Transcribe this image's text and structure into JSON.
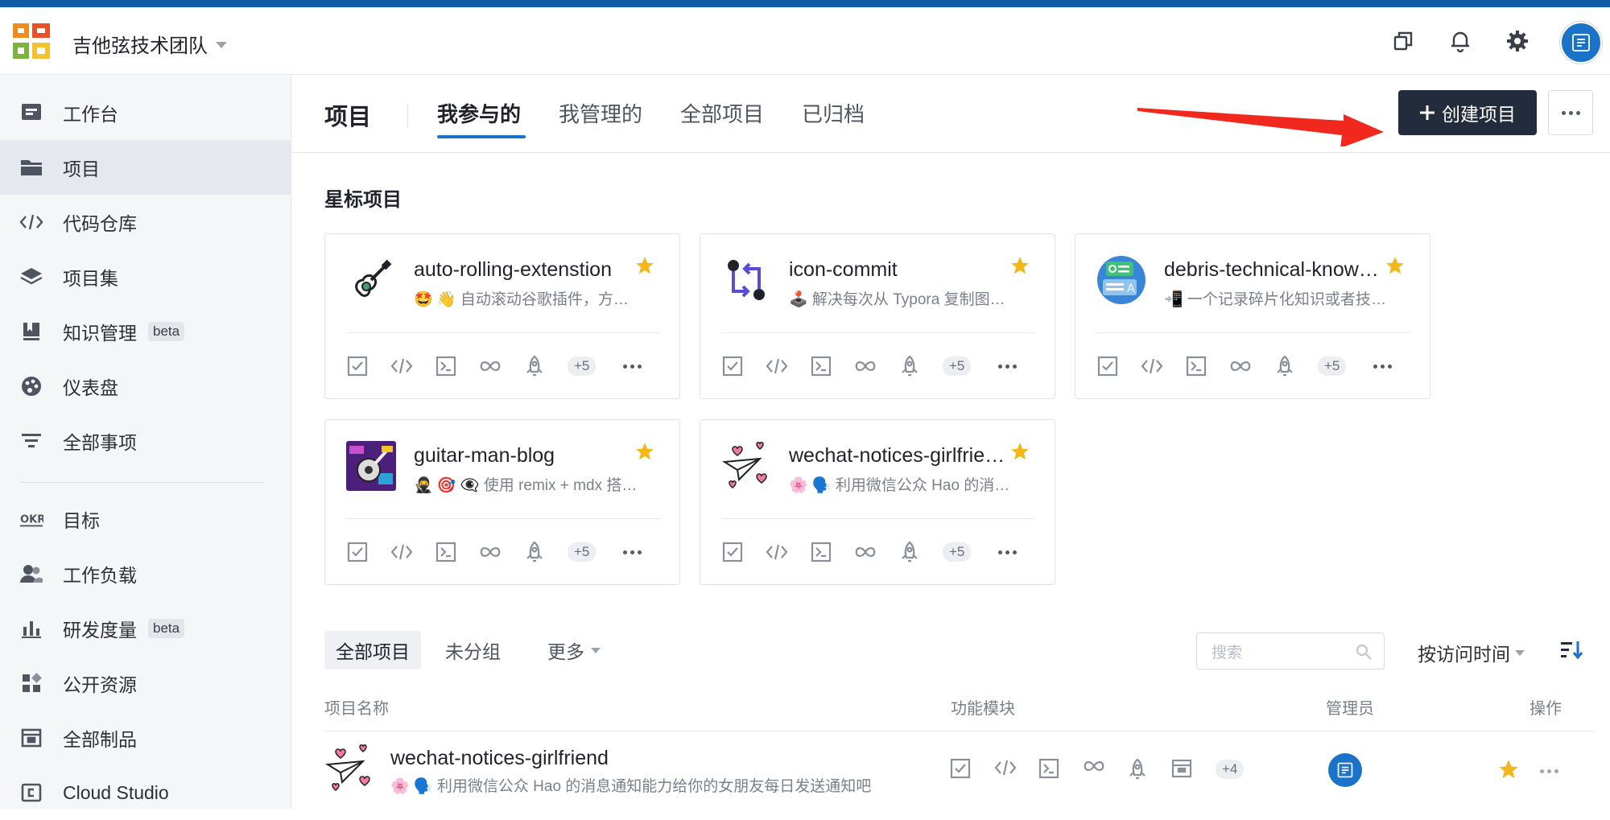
{
  "header": {
    "team_name": "吉他弦技术团队"
  },
  "sidebar": {
    "items": [
      {
        "label": "工作台",
        "icon": "desktop-icon"
      },
      {
        "label": "项目",
        "icon": "folder-icon",
        "active": true
      },
      {
        "label": "代码仓库",
        "icon": "code-icon"
      },
      {
        "label": "项目集",
        "icon": "layers-icon"
      },
      {
        "label": "知识管理",
        "icon": "book-icon",
        "badge": "beta"
      },
      {
        "label": "仪表盘",
        "icon": "palette-icon"
      },
      {
        "label": "全部事项",
        "icon": "filter-icon"
      },
      {
        "label": "目标",
        "icon": "okr-icon"
      },
      {
        "label": "工作负载",
        "icon": "users-icon"
      },
      {
        "label": "研发度量",
        "icon": "bar-chart-icon",
        "badge": "beta"
      },
      {
        "label": "公开资源",
        "icon": "apps-icon"
      },
      {
        "label": "全部制品",
        "icon": "package-icon"
      },
      {
        "label": "Cloud Studio",
        "icon": "cloud-studio-icon"
      }
    ],
    "okr_text": "OKR"
  },
  "page": {
    "title": "项目",
    "tabs": [
      "我参与的",
      "我管理的",
      "全部项目",
      "已归档"
    ],
    "active_tab": "我参与的",
    "create_button": "创建项目"
  },
  "starred": {
    "title": "星标项目",
    "cards": [
      {
        "name": "auto-rolling-extenstion",
        "desc": "🤩 👋 自动滚动谷歌插件，方便阅读长文",
        "more": "+5"
      },
      {
        "name": "icon-commit",
        "desc": "🕹️ 解决每次从 Typora 复制图片链接",
        "more": "+5"
      },
      {
        "name": "debris-technical-knowledge",
        "desc": "📲 一个记录碎片化知识或者技术的仓库",
        "more": "+5"
      },
      {
        "name": "guitar-man-blog",
        "desc": "🥷 🎯 👁‍🗨 使用 remix + mdx 搭建的博客",
        "more": "+5"
      },
      {
        "name": "wechat-notices-girlfriend",
        "desc": "🌸 🗣️ 利用微信公众 Hao 的消息通知能力",
        "more": "+5"
      }
    ]
  },
  "list": {
    "filters": [
      "全部项目",
      "未分组",
      "更多"
    ],
    "search_placeholder": "搜索",
    "sort_label": "按访问时间",
    "columns": [
      "项目名称",
      "功能模块",
      "管理员",
      "操作"
    ],
    "rows": [
      {
        "name": "wechat-notices-girlfriend",
        "desc": "🌸 🗣️ 利用微信公众 Hao 的消息通知能力给你的女朋友每日发送通知吧",
        "more": "+4"
      }
    ]
  },
  "colors": {
    "accent": "#1a73c9",
    "create_button_bg": "#232c3d",
    "star": "#f5b619",
    "arrow": "#f0281e"
  }
}
